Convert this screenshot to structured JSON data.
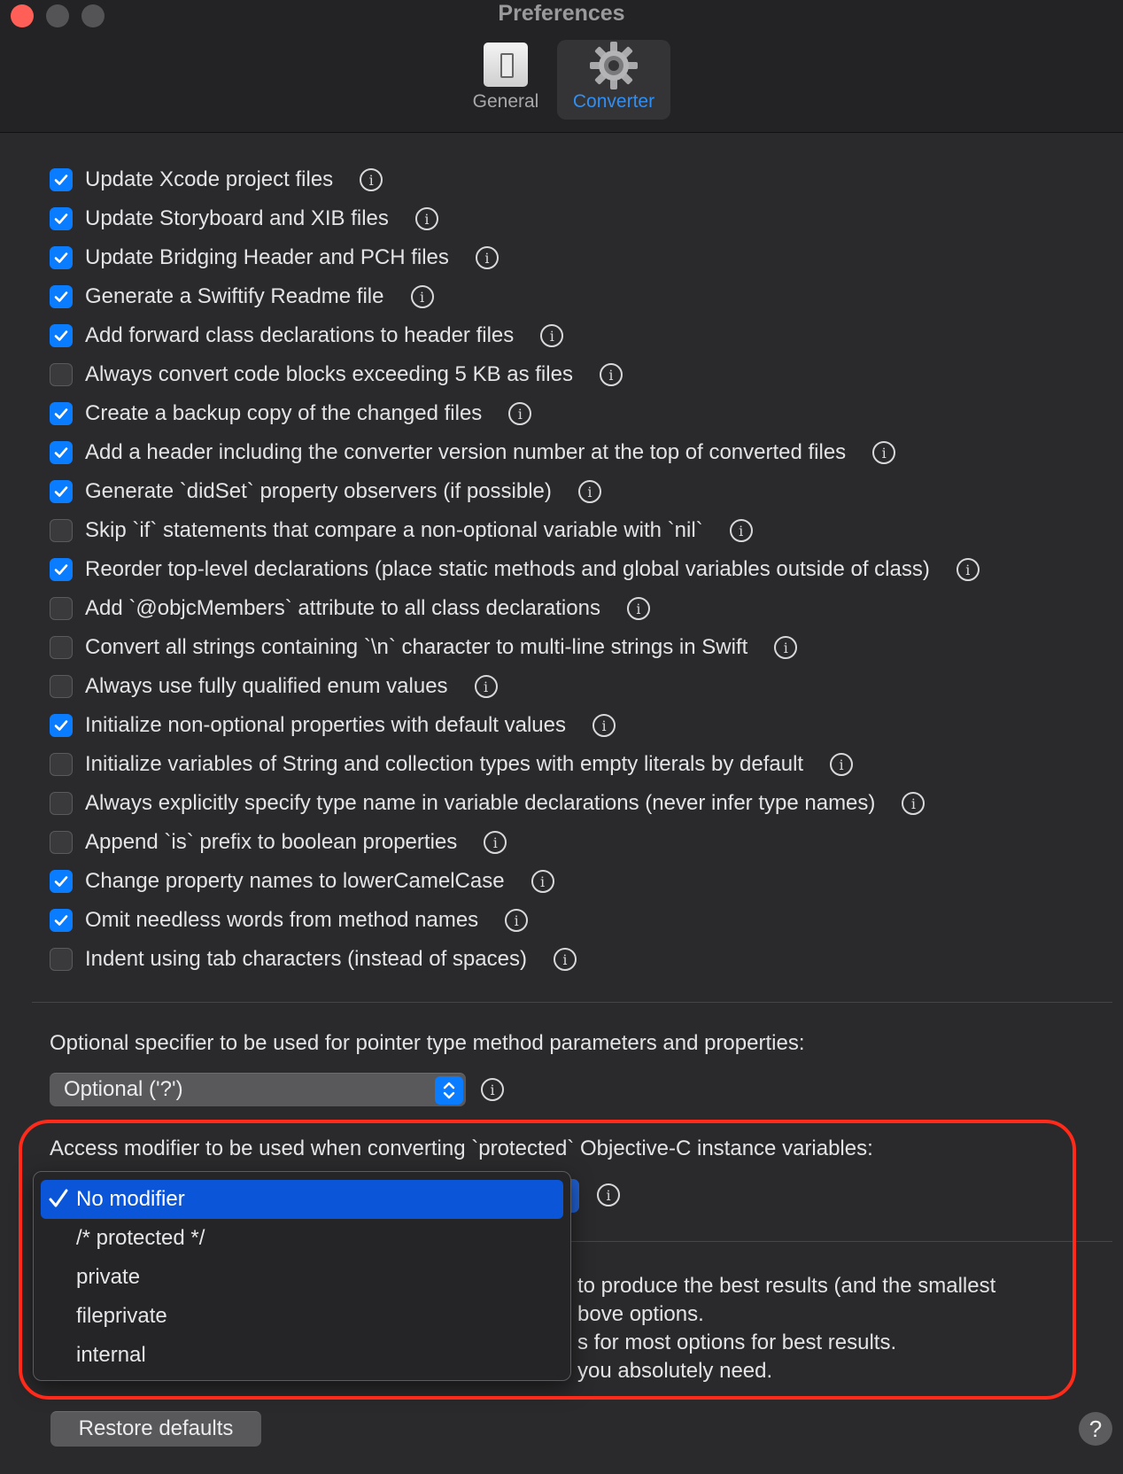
{
  "window": {
    "title": "Preferences"
  },
  "toolbar": {
    "general_label": "General",
    "converter_label": "Converter",
    "selected": "Converter"
  },
  "options": [
    {
      "label": "Update Xcode project files",
      "checked": true
    },
    {
      "label": "Update Storyboard and XIB files",
      "checked": true
    },
    {
      "label": "Update Bridging Header and PCH files",
      "checked": true
    },
    {
      "label": "Generate a Swiftify Readme file",
      "checked": true
    },
    {
      "label": "Add forward class declarations to header files",
      "checked": true
    },
    {
      "label": "Always convert code blocks exceeding 5 KB as files",
      "checked": false
    },
    {
      "label": "Create a backup copy of the changed files",
      "checked": true
    },
    {
      "label": "Add a header including the converter version number at the top of converted files",
      "checked": true
    },
    {
      "label": "Generate `didSet` property observers (if possible)",
      "checked": true
    },
    {
      "label": "Skip `if` statements that compare a non-optional variable with `nil`",
      "checked": false
    },
    {
      "label": "Reorder top-level declarations (place static methods and global variables outside of class)",
      "checked": true
    },
    {
      "label": "Add `@objcMembers` attribute to all class declarations",
      "checked": false
    },
    {
      "label": "Convert all strings containing `\\n` character to multi-line strings in Swift",
      "checked": false
    },
    {
      "label": "Always use fully qualified enum values",
      "checked": false
    },
    {
      "label": "Initialize non-optional properties with default values",
      "checked": true
    },
    {
      "label": "Initialize variables of String and collection types with empty literals by default",
      "checked": false
    },
    {
      "label": "Always explicitly specify type name in variable declarations (never infer type names)",
      "checked": false
    },
    {
      "label": "Append `is` prefix to boolean properties",
      "checked": false
    },
    {
      "label": "Change property names to lowerCamelCase",
      "checked": true
    },
    {
      "label": "Omit needless words from method names",
      "checked": true
    },
    {
      "label": "Indent using tab characters (instead of spaces)",
      "checked": false
    }
  ],
  "pointer_specifier": {
    "label": "Optional specifier to be used for pointer type method parameters and properties:",
    "value": "Optional ('?')"
  },
  "access_modifier": {
    "label": "Access modifier to be used when converting `protected` Objective-C instance variables:",
    "menu_items": [
      {
        "label": "No modifier",
        "selected": true
      },
      {
        "label": "/* protected */",
        "selected": false
      },
      {
        "label": "private",
        "selected": false
      },
      {
        "label": "fileprivate",
        "selected": false
      },
      {
        "label": "internal",
        "selected": false
      }
    ]
  },
  "tip_lines": [
    "to produce the best results (and the smallest",
    "bove options.",
    "s for most options for best results.",
    "you absolutely need."
  ],
  "footer": {
    "restore_label": "Restore defaults",
    "help_label": "?"
  },
  "colors": {
    "accent": "#0a7cff",
    "annotation_outline": "#ff2a1a",
    "background": "#2a2a2c"
  }
}
